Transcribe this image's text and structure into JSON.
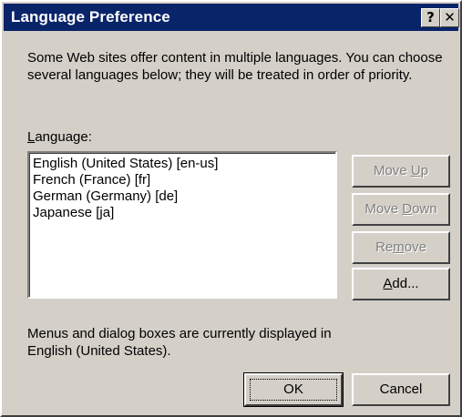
{
  "dialog": {
    "title": "Language Preference",
    "help_glyph": "?",
    "close_glyph": "✕",
    "description": "Some Web sites offer content in multiple languages. You can choose several languages below; they will be treated in order of priority.",
    "language_label_accel": "L",
    "language_label_rest": "anguage:",
    "languages": [
      "English (United States) [en-us]",
      "French (France) [fr]",
      "German (Germany) [de]",
      "Japanese [ja]"
    ],
    "buttons": {
      "move_up_pre": "Move ",
      "move_up_accel": "U",
      "move_up_post": "p",
      "move_down_pre": "Move ",
      "move_down_accel": "D",
      "move_down_post": "own",
      "remove_pre": "Re",
      "remove_accel": "m",
      "remove_post": "ove",
      "add_accel": "A",
      "add_post": "dd...",
      "ok": "OK",
      "cancel": "Cancel"
    },
    "status_text": "Menus and dialog boxes are currently displayed in English (United States)."
  }
}
